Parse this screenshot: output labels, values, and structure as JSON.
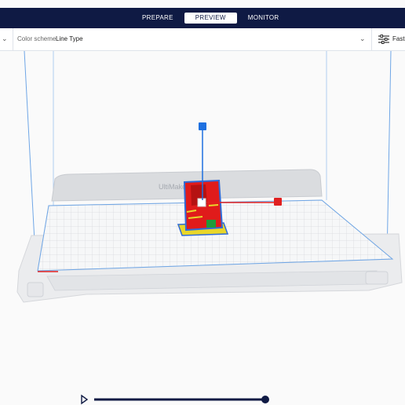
{
  "tabs": [
    {
      "label": "PREPARE"
    },
    {
      "label": "PREVIEW"
    },
    {
      "label": "MONITOR"
    }
  ],
  "active_tab": "PREVIEW",
  "toolbar": {
    "color_scheme_label": "Color scheme",
    "color_scheme_value": "Line Type",
    "profile_label": "Fast -"
  },
  "scene": {
    "build_plate_brand": "UltiMaker"
  },
  "playback": {
    "progress": 1.0
  },
  "colors": {
    "header_bg": "#0f1a44",
    "wall_outer": "#e01b1b",
    "wall_inner": "#2f6bd8",
    "infill": "#e8d62a",
    "support": "#1f9c3a",
    "axis_x": "#e02020",
    "axis_z": "#1e70e0"
  }
}
